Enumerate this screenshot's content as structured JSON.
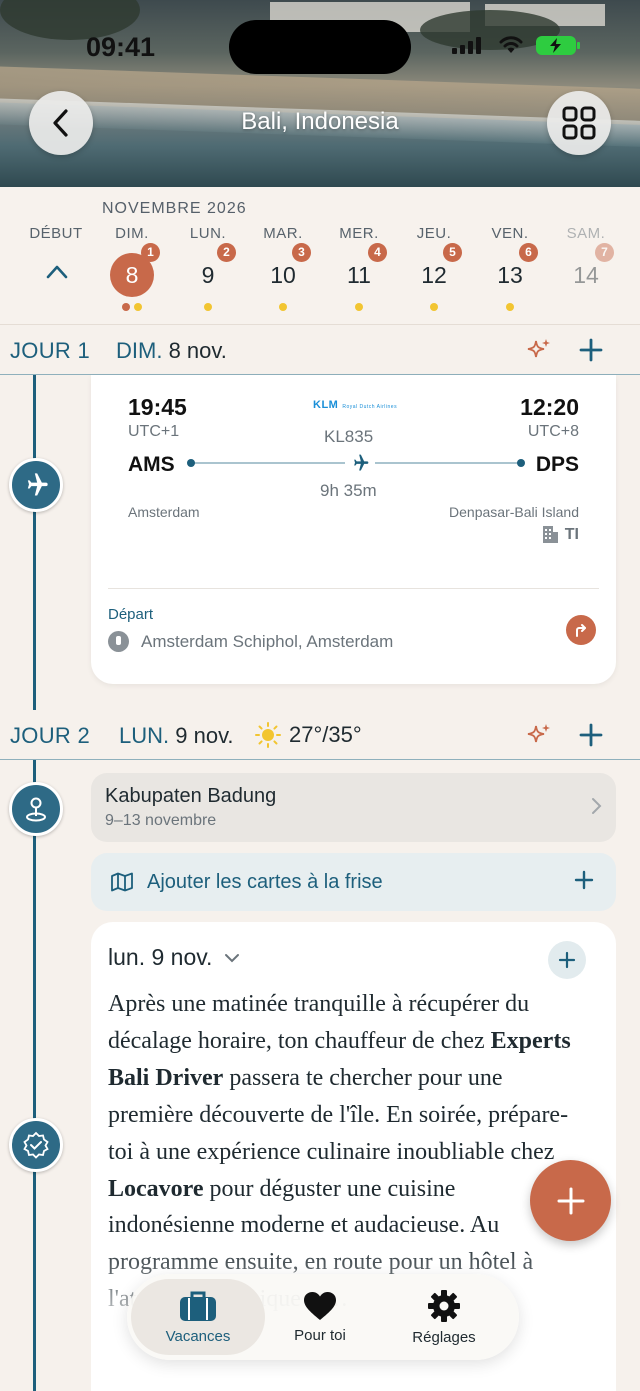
{
  "status": {
    "time": "09:41"
  },
  "header": {
    "title": "Bali, Indonesia"
  },
  "calendar": {
    "month": "NOVEMBRE 2026",
    "start_label": "DÉBUT",
    "days": [
      {
        "name": "DIM.",
        "num": "8",
        "badge": "1",
        "selected": true
      },
      {
        "name": "LUN.",
        "num": "9",
        "badge": "2"
      },
      {
        "name": "MAR.",
        "num": "10",
        "badge": "3"
      },
      {
        "name": "MER.",
        "num": "11",
        "badge": "4"
      },
      {
        "name": "JEU.",
        "num": "12",
        "badge": "5"
      },
      {
        "name": "VEN.",
        "num": "13",
        "badge": "6"
      },
      {
        "name": "SAM.",
        "num": "14",
        "badge": "7"
      }
    ]
  },
  "day1": {
    "label": "JOUR 1",
    "weekday": "DIM.",
    "date": "8 nov."
  },
  "flight": {
    "dep_time": "19:45",
    "dep_tz": "UTC+1",
    "dep_code": "AMS",
    "dep_city": "Amsterdam",
    "arr_time": "12:20",
    "arr_tz": "UTC+8",
    "arr_code": "DPS",
    "arr_city": "Denpasar-Bali Island",
    "airline_logo": "KLM",
    "airline_sub": "Royal Dutch Airlines",
    "number": "KL835",
    "duration": "9h 35m",
    "terminal": "TI",
    "departure_label": "Départ",
    "departure_place": "Amsterdam Schiphol, Amsterdam"
  },
  "day2": {
    "label": "JOUR 2",
    "weekday": "LUN.",
    "date": "9 nov.",
    "weather": "27°/35°"
  },
  "stay": {
    "name": "Kabupaten Badung",
    "dates": "9–13 novembre"
  },
  "add_maps": {
    "label": "Ajouter les cartes à la frise"
  },
  "note": {
    "header": "lun. 9 nov.",
    "p1": "Après une matinée tranquille à récupérer du décalage horaire, ton chauffeur de chez ",
    "b1": "Experts Bali Driver",
    "p2": " passera te chercher pour une première découverte de l'île. En soirée, prépare-toi à une expérience culinaire inoubliable chez ",
    "b2": "Locavore",
    "p3": " pour déguster une cuisine indonésienne moderne et audacieuse. Au programme ensuite, en route pour un hôtel à l'atmosphère unique et…"
  },
  "tabs": [
    {
      "label": "Vacances",
      "icon": "suitcase-icon"
    },
    {
      "label": "Pour toi",
      "icon": "heart-icon"
    },
    {
      "label": "Réglages",
      "icon": "gear-icon"
    }
  ],
  "colors": {
    "accent": "#c8694a",
    "primary": "#1d5f7c",
    "dot": "#f2c531"
  }
}
